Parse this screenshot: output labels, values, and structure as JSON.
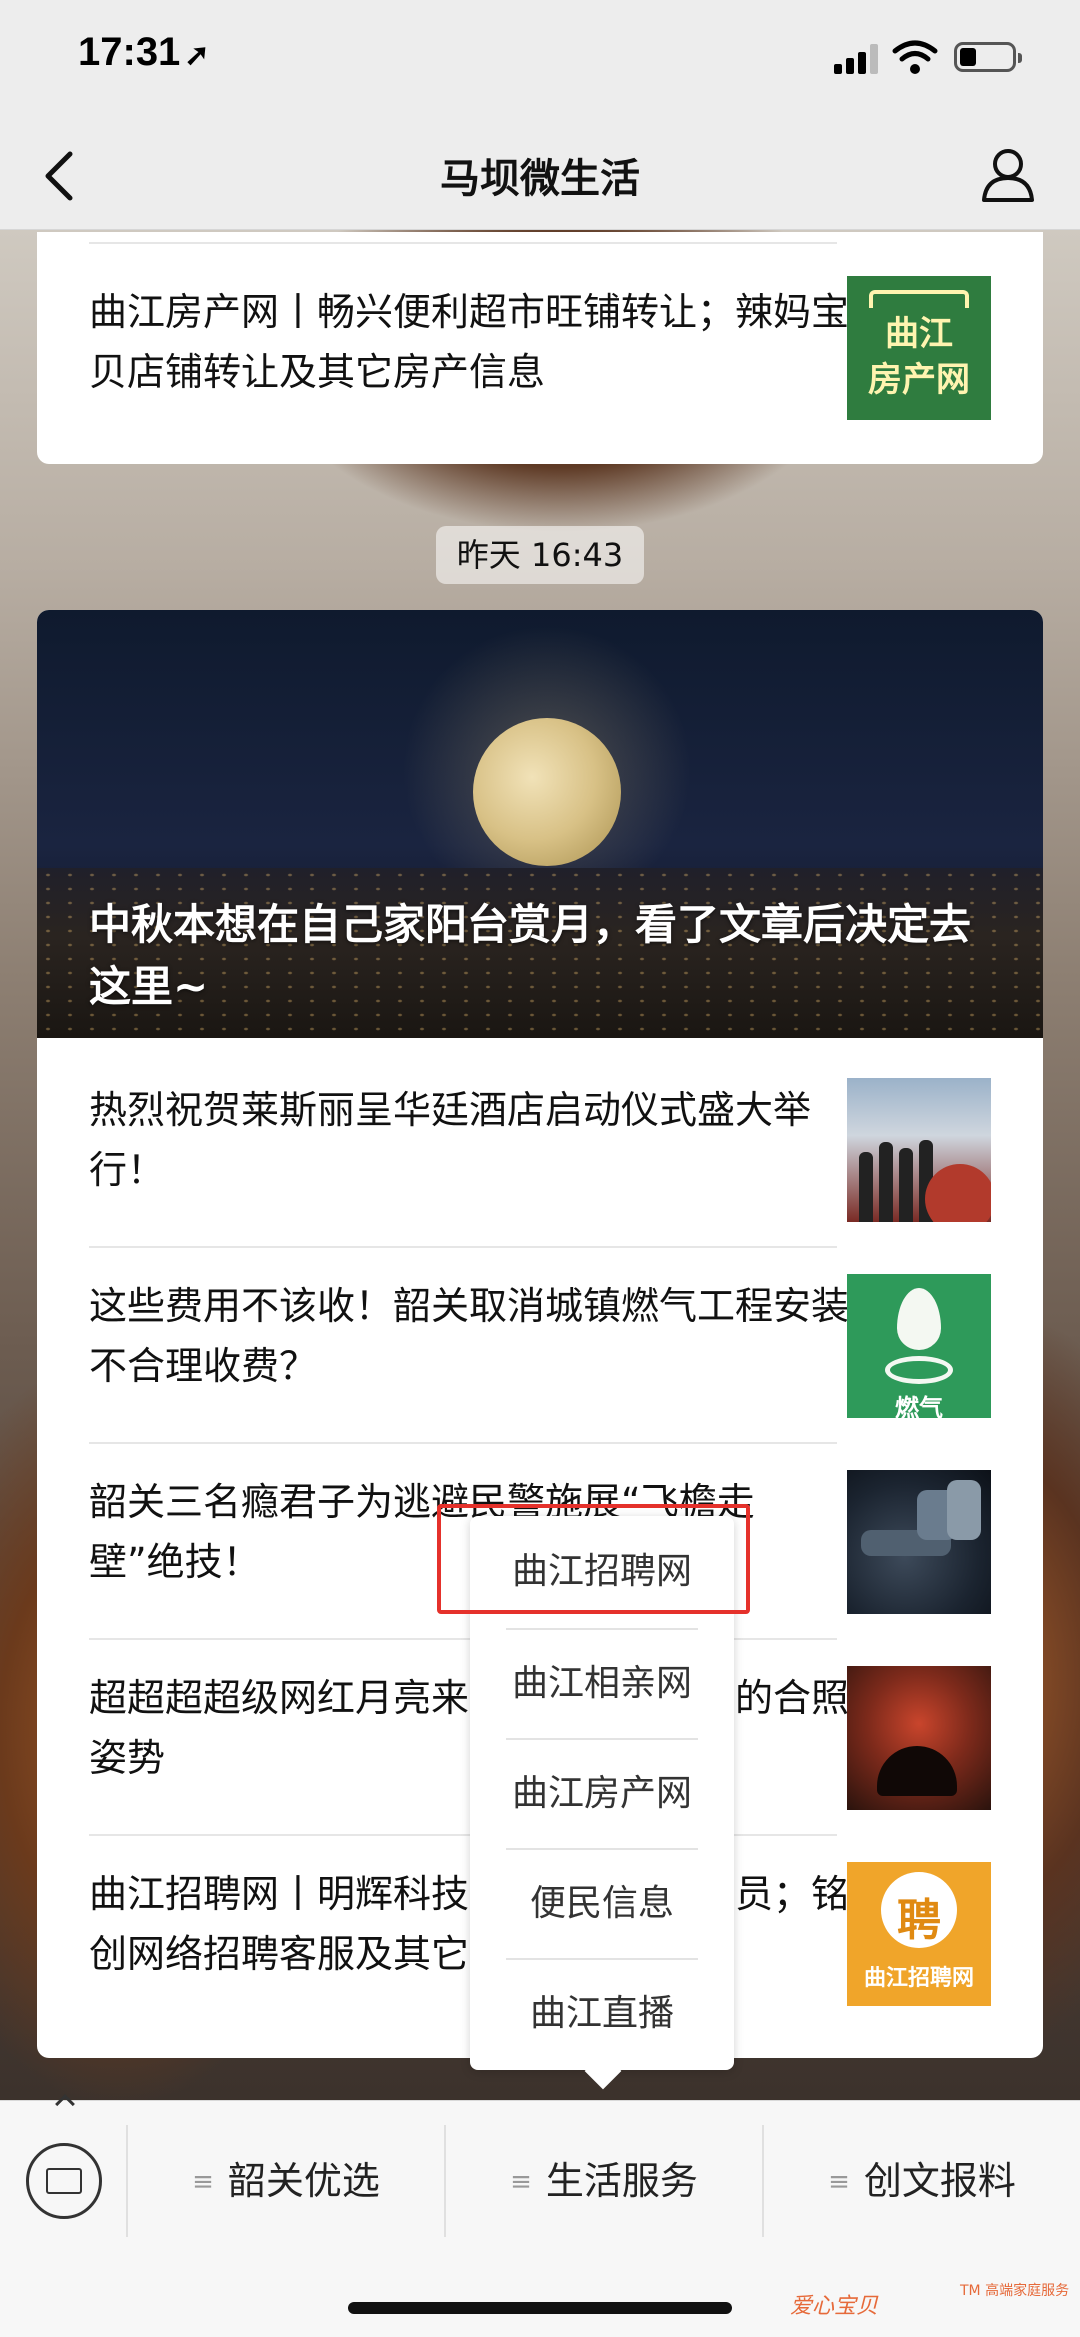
{
  "status_bar": {
    "time": "17:31",
    "location_icon": "location-arrow-icon"
  },
  "nav": {
    "title": "马坝微生活",
    "back_icon": "chevron-left-icon",
    "profile_icon": "profile-icon"
  },
  "top_card": {
    "article": {
      "title": "曲江房产网丨畅兴便利超市旺铺转让；辣妈宝贝店铺转让及其它房产信息",
      "thumb_line1": "曲江",
      "thumb_line2": "房产网"
    }
  },
  "time_badge": "昨天 16:43",
  "feed": {
    "hero_title": "中秋本想在自己家阳台赏月，看了文章后决定去这里~",
    "articles": [
      {
        "title": "热烈祝贺莱斯丽呈华廷酒店启动仪式盛大举行！"
      },
      {
        "title": "这些费用不该收！韶关取消城镇燃气工程安装不合理收费？",
        "thumb_label": "燃气"
      },
      {
        "title": "韶关三名瘾君子为逃避民警施展“飞檐走壁”绝技！"
      },
      {
        "title": "超超超超级网红月亮来了，这才是正确的合照姿势"
      },
      {
        "title": "曲江招聘网丨明辉科技招聘业务员和文员；铭创网络招聘客服及其它服务",
        "thumb_char": "聘",
        "thumb_label": "曲江招聘网"
      }
    ]
  },
  "popup_menu": {
    "items": [
      "曲江招聘网",
      "曲江相亲网",
      "曲江房产网",
      "便民信息",
      "曲江直播"
    ]
  },
  "bottom_menu": {
    "keyboard_icon": "keyboard-icon",
    "items": [
      "韶关优选",
      "生活服务",
      "创文报料"
    ],
    "item_icon": "≡"
  },
  "watermark": {
    "text": "爱心宝贝",
    "sub": "TM 高端家庭服务"
  },
  "colors": {
    "highlight": "#e5312b",
    "nav_bg": "#ededed"
  }
}
